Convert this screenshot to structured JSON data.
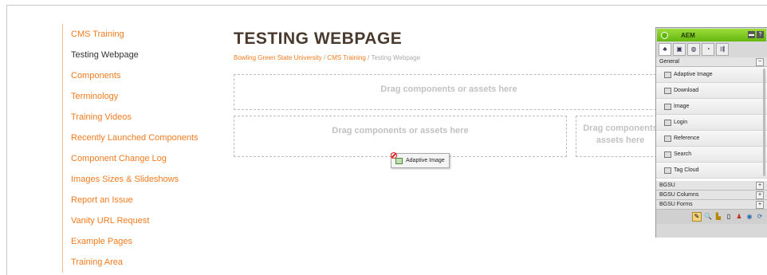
{
  "nav": {
    "items": [
      "CMS Training",
      "Testing Webpage",
      "Components",
      "Terminology",
      "Training Videos",
      "Recently Launched Components",
      "Component Change Log",
      "Images Sizes & Slideshows",
      "Report an Issue",
      "Vanity URL Request",
      "Example Pages",
      "Training Area"
    ],
    "current_index": 1
  },
  "page": {
    "title": "TESTING WEBPAGE",
    "breadcrumb": [
      "Bowling Green State University",
      "CMS Training",
      "Testing Webpage"
    ],
    "breadcrumb_sep": "/"
  },
  "dropzones": {
    "top": "Drag components or assets here",
    "left": "Drag components or assets here",
    "right_line1": "Drag components",
    "right_line2": "assets here"
  },
  "drag": {
    "label": "Adaptive Image"
  },
  "sidekick": {
    "title": "AEM",
    "sections": {
      "general": "General",
      "bgsu": "BGSU",
      "bgsu_columns": "BGSU Columns",
      "bgsu_forms": "BGSU Forms"
    },
    "components": [
      "Adaptive Image",
      "Download",
      "Image",
      "Login",
      "Reference",
      "Search",
      "Tag Cloud"
    ],
    "icons": [
      "image-icon",
      "download-icon",
      "image-icon",
      "login-icon",
      "reference-icon",
      "search-icon",
      "tag-cloud-icon"
    ]
  },
  "colors": {
    "accent": "#f07b1f",
    "aem_green": "#62b80e",
    "title": "#4a3a2e"
  }
}
